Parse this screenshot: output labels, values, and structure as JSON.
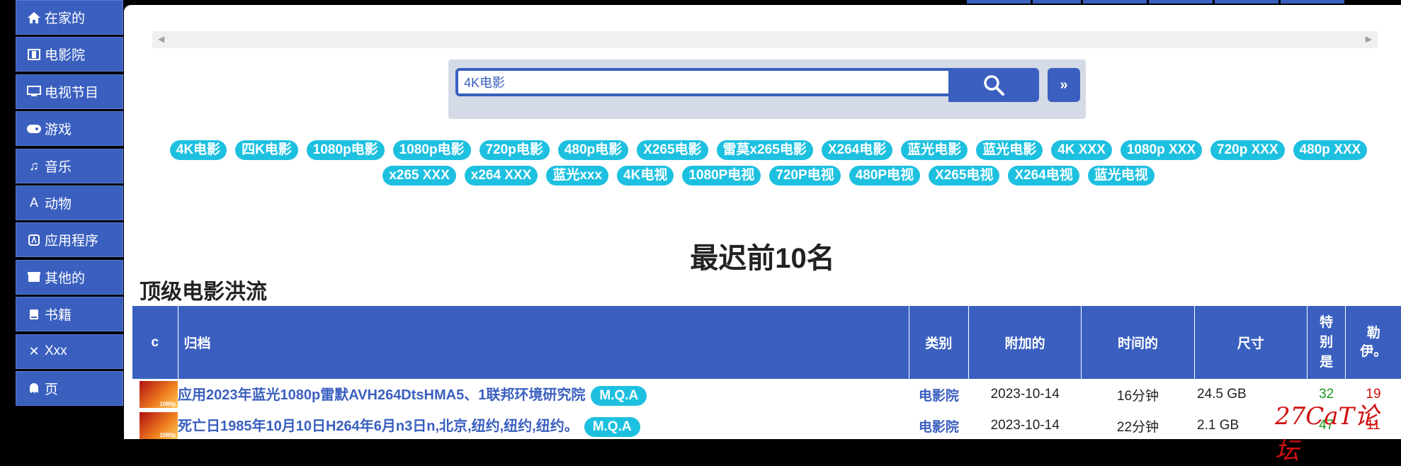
{
  "sidebar": {
    "items": [
      {
        "label": "在家的",
        "icon": "home-icon"
      },
      {
        "label": "电影院",
        "icon": "film-icon"
      },
      {
        "label": "电视节目",
        "icon": "tv-icon"
      },
      {
        "label": "游戏",
        "icon": "gamepad-icon"
      },
      {
        "label": "音乐",
        "icon": "music-icon"
      },
      {
        "label": "动物",
        "icon": "anime-icon"
      },
      {
        "label": "应用程序",
        "icon": "app-store-icon"
      },
      {
        "label": "其他的",
        "icon": "box-icon"
      },
      {
        "label": "书籍",
        "icon": "book-icon"
      },
      {
        "label": "Xxx",
        "icon": "x-icon"
      },
      {
        "label": "页",
        "icon": "ghost-icon"
      }
    ]
  },
  "search": {
    "value": "4K电影",
    "more_label": "»"
  },
  "tags": [
    "4K电影",
    "四K电影",
    "1080p电影",
    "1080p电影",
    "720p电影",
    "480p电影",
    "X265电影",
    "雷莫x265电影",
    "X264电影",
    "蓝光电影",
    "蓝光电影",
    "4K XXX",
    "1080p XXX",
    "720p XXX",
    "480p XXX",
    "x265 XXX",
    "x264 XXX",
    "蓝光xxx",
    "4K电视",
    "1080P电视",
    "720P电视",
    "480P电视",
    "X265电视",
    "X264电视",
    "蓝光电视"
  ],
  "headings": {
    "top": "最迟前10名",
    "section": "顶级电影洪流"
  },
  "table": {
    "headers": {
      "c": "c",
      "name": "归档",
      "category": "类别",
      "added": "附加的",
      "time": "时间的",
      "size": "尺寸",
      "seed": "特别是",
      "leech": "勒伊。"
    },
    "rows": [
      {
        "title": "应用2023年蓝光1080p雷默AVH264DtsHMA5、1联邦环境研究院",
        "badge": "M.Q.A",
        "category": "电影院",
        "added": "2023-10-14",
        "time": "16分钟",
        "size": "24.5 GB",
        "seed": "32",
        "leech": "19",
        "thumb": "1080p"
      },
      {
        "title": "死亡日1985年10月10日H264年6月n3日n,北京,纽约,纽约,纽约。",
        "badge": "M.Q.A",
        "category": "电影院",
        "added": "2023-10-14",
        "time": "22分钟",
        "size": "2.1 GB",
        "seed": "47",
        "leech": "11",
        "thumb": "1080p"
      }
    ]
  },
  "watermark": "27CaT论坛"
}
